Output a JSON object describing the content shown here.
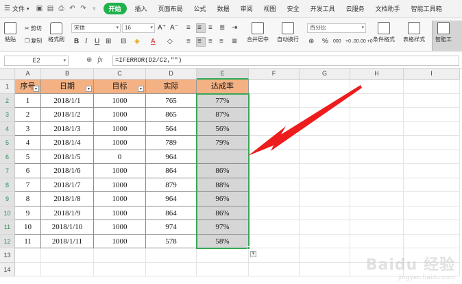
{
  "menubar": {
    "file_label": "文件",
    "tabs": [
      "开始",
      "插入",
      "页面布局",
      "公式",
      "数据",
      "审阅",
      "视图",
      "安全",
      "开发工具",
      "云服务",
      "文档助手",
      "智能工具箱"
    ],
    "active_tab": "开始"
  },
  "ribbon": {
    "paste": "粘贴",
    "cut": "剪切",
    "copy": "复制",
    "format_painter": "格式刷",
    "font_name": "宋体",
    "font_size": "16",
    "merge_center": "合并居中",
    "wrap_text": "自动换行",
    "number_format": "百分比",
    "conditional_format": "条件格式",
    "table_style": "表格样式",
    "smart_tools": "智能工",
    "glyphs": {
      "grow": "A⁺",
      "shrink": "A⁻",
      "bold": "B",
      "italic": "I",
      "underline": "U",
      "font_color": "A",
      "percent": "%",
      "thousands": "000",
      "inc_decimal": "+0 .00",
      "dec_decimal": ".00 +0"
    }
  },
  "formula_bar": {
    "name_box": "E2",
    "fx": "fx",
    "formula": "=IFERROR(D2/C2,\"\")"
  },
  "sheet": {
    "columns": [
      "A",
      "B",
      "C",
      "D",
      "E",
      "F",
      "G",
      "H",
      "I"
    ],
    "active_column": "E",
    "row_numbers": [
      "1",
      "2",
      "3",
      "4",
      "5",
      "6",
      "7",
      "8",
      "9",
      "10",
      "11",
      "12",
      "13",
      "14"
    ],
    "headers": [
      "序号",
      "日期",
      "目标",
      "实际",
      "达成率"
    ],
    "rows": [
      [
        "1",
        "2018/1/1",
        "1000",
        "765",
        "77%"
      ],
      [
        "2",
        "2018/1/2",
        "1000",
        "865",
        "87%"
      ],
      [
        "3",
        "2018/1/3",
        "1000",
        "564",
        "56%"
      ],
      [
        "4",
        "2018/1/4",
        "1000",
        "789",
        "79%"
      ],
      [
        "5",
        "2018/1/5",
        "0",
        "964",
        ""
      ],
      [
        "6",
        "2018/1/6",
        "1000",
        "864",
        "86%"
      ],
      [
        "7",
        "2018/1/7",
        "1000",
        "879",
        "88%"
      ],
      [
        "8",
        "2018/1/8",
        "1000",
        "964",
        "96%"
      ],
      [
        "9",
        "2018/1/9",
        "1000",
        "864",
        "86%"
      ],
      [
        "10",
        "2018/1/10",
        "1000",
        "974",
        "97%"
      ],
      [
        "11",
        "2018/1/11",
        "1000",
        "578",
        "58%"
      ]
    ],
    "header_fill_color": "#f4b183",
    "selection_color": "#3aa657"
  },
  "annotation": {
    "arrow_color": "#ee1c1c",
    "icon": "red-arrow-pointer"
  },
  "watermark": {
    "line1": "Baidu 经验",
    "line2": "jingyan.baidu.com"
  }
}
